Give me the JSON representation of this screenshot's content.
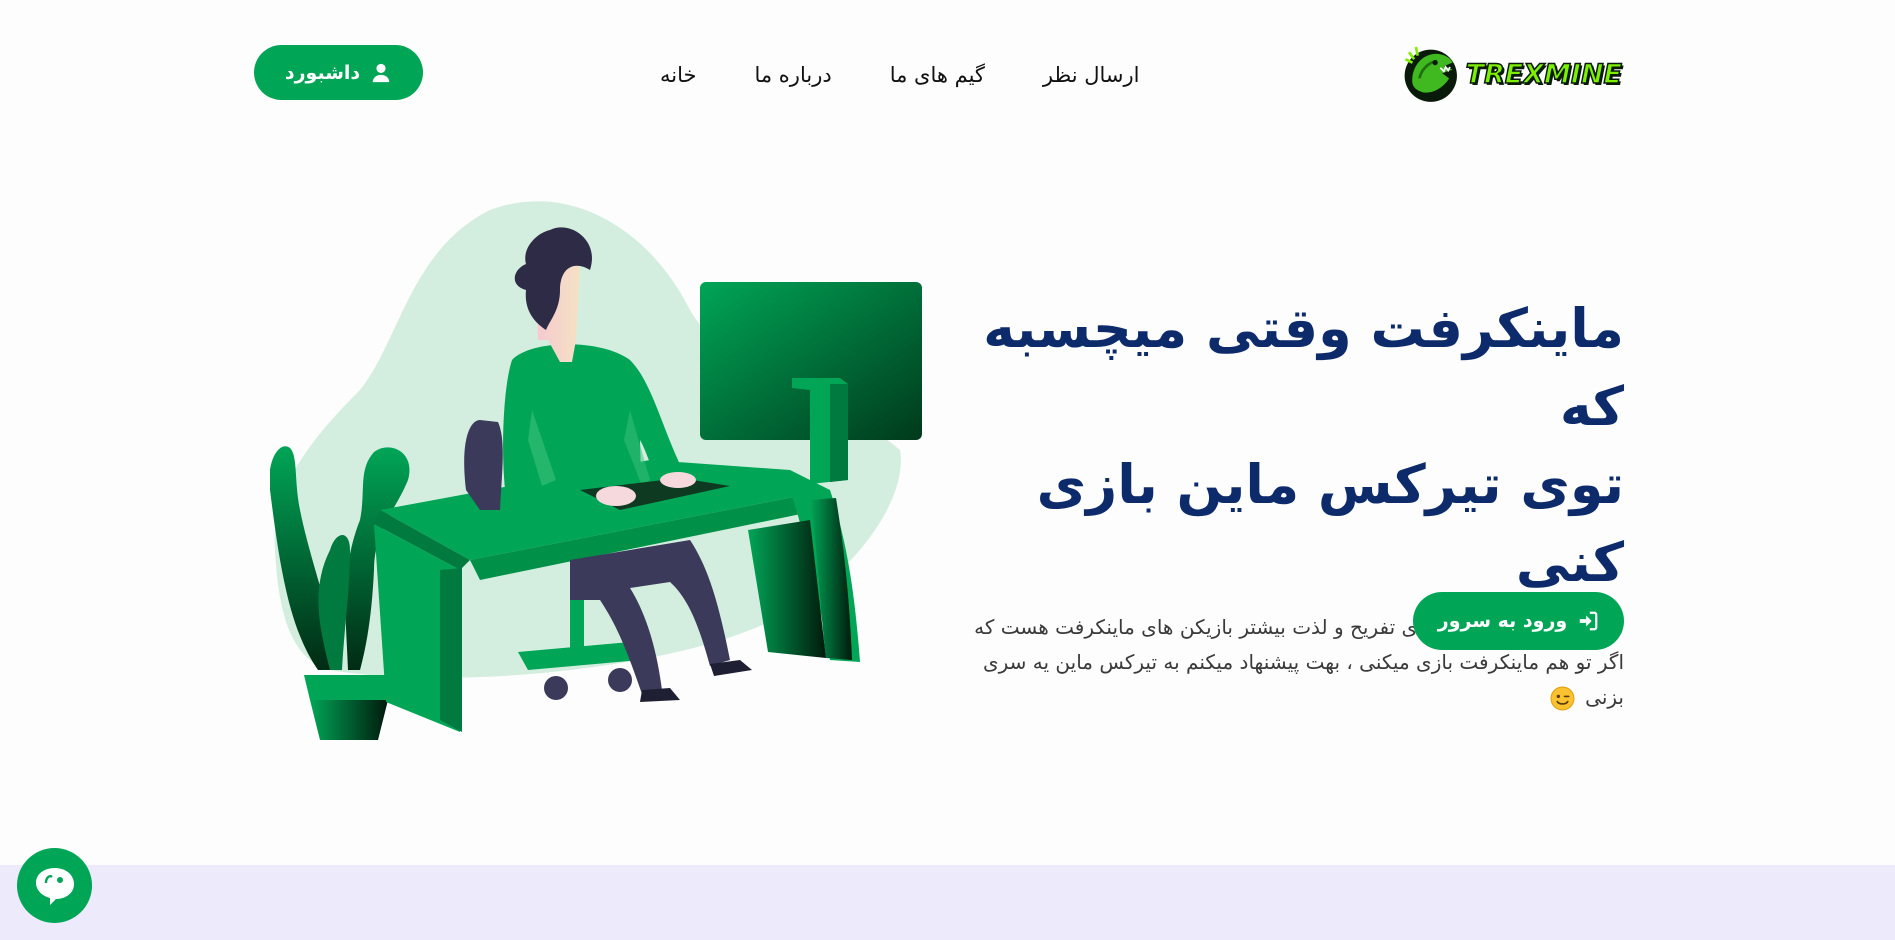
{
  "header": {
    "dashboard_label": "داشبورد",
    "logo_text": "TREXMINE",
    "nav": [
      {
        "label": "خانه"
      },
      {
        "label": "درباره ما"
      },
      {
        "label": "گیم های ما"
      },
      {
        "label": "ارسال نظر"
      }
    ]
  },
  "hero": {
    "title_line1": "ماینکرفت وقتی میچسبه که",
    "title_line2": "توی تیرکس ماین بازی کنی",
    "description": "تیرکس ماین یک بستر برای تفریح و لذت بیشتر بازیکن های ماینکرفت هست که اگر تو هم ماینکرفت بازی میکنی ، بهت پیشنهاد میکنم به تیرکس ماین یه سری بزنی",
    "enter_button_label": "ورود به سرور"
  },
  "icons": {
    "dashboard": "user-icon",
    "enter": "sign-in-icon",
    "chat": "chat-icon",
    "emoji": "wink-emoji-icon"
  },
  "colors": {
    "brand_green": "#00a556",
    "title_navy": "#0d2b6b",
    "bottom_band": "#eceafb",
    "logo_lime": "#7cf000"
  }
}
